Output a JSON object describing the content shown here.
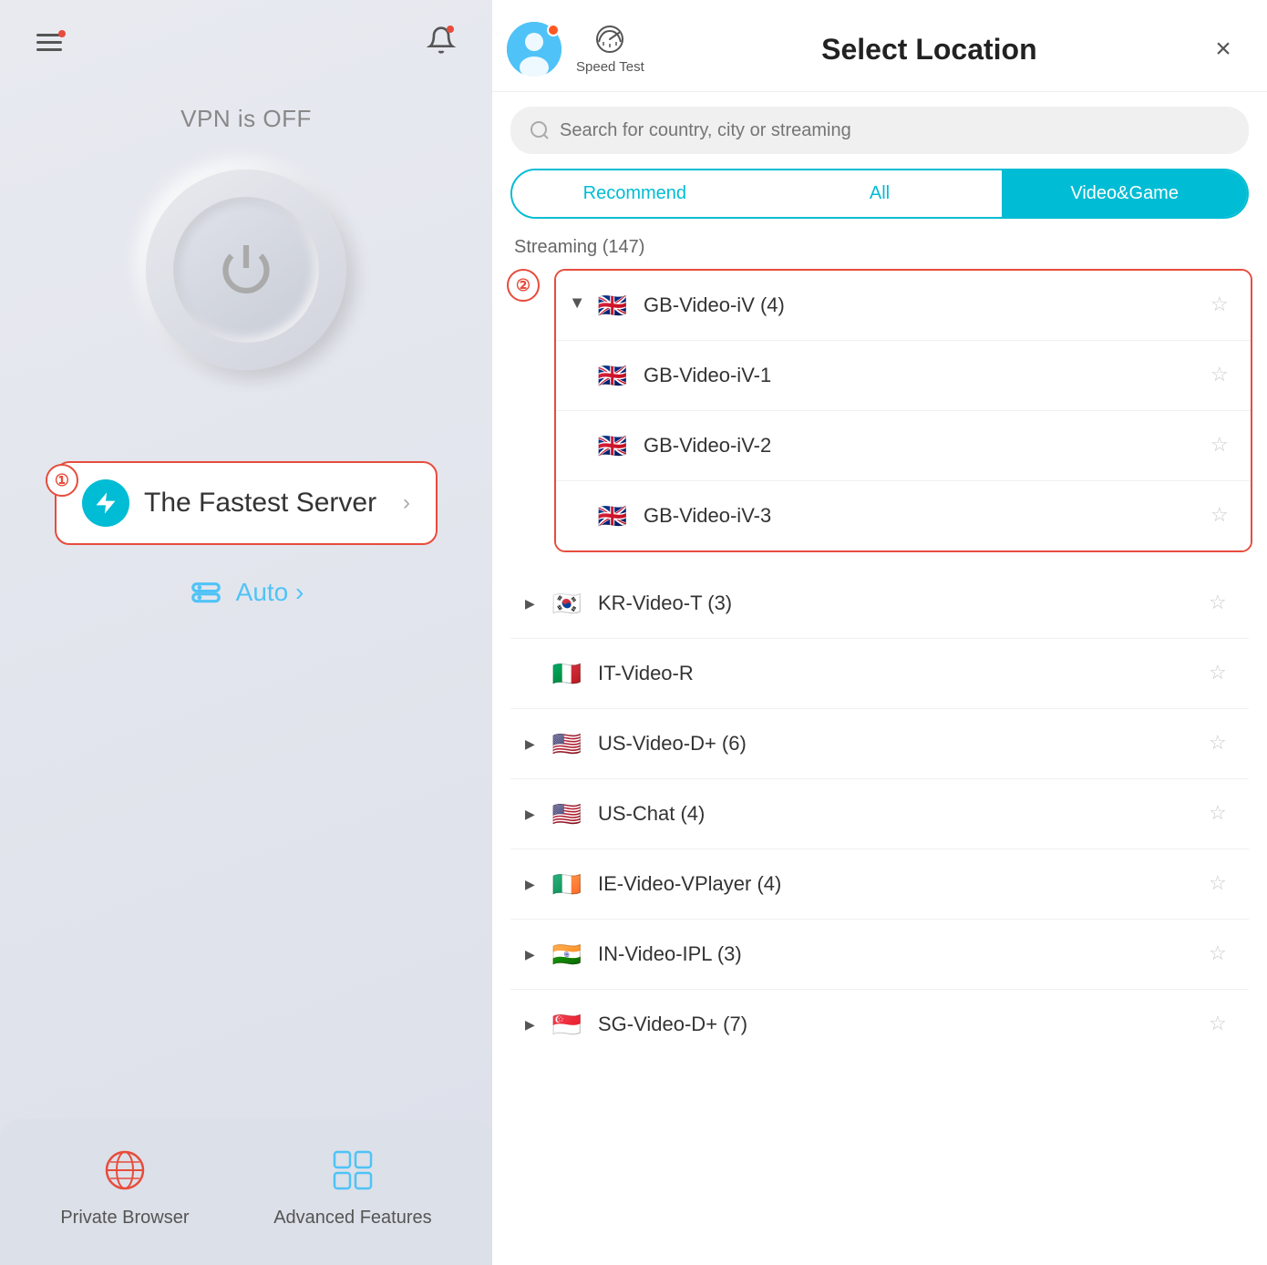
{
  "left": {
    "vpn_status": "VPN is OFF",
    "fastest_server_label": "The Fastest Server",
    "fastest_server_chevron": "›",
    "auto_label": "Auto ›",
    "bottom_items": [
      {
        "id": "private-browser",
        "label": "Private Browser"
      },
      {
        "id": "advanced-features",
        "label": "Advanced Features"
      }
    ],
    "annotation1": "①"
  },
  "right": {
    "header": {
      "speed_test_label": "Speed Test",
      "title": "Select Location",
      "close_label": "×"
    },
    "search": {
      "placeholder": "Search for country, city or streaming"
    },
    "tabs": [
      {
        "id": "recommend",
        "label": "Recommend",
        "active": false
      },
      {
        "id": "all",
        "label": "All",
        "active": false
      },
      {
        "id": "videogame",
        "label": "Video&Game",
        "active": true
      }
    ],
    "streaming_header": "Streaming (147)",
    "annotation2": "②",
    "location_groups": [
      {
        "id": "gb-video-iv",
        "parent": "GB-Video-iV (4)",
        "flag": "🇬🇧",
        "expanded": true,
        "highlighted": true,
        "children": [
          {
            "id": "gb-video-iv-1",
            "name": "GB-Video-iV-1",
            "flag": "🇬🇧"
          },
          {
            "id": "gb-video-iv-2",
            "name": "GB-Video-iV-2",
            "flag": "🇬🇧"
          },
          {
            "id": "gb-video-iv-3",
            "name": "GB-Video-iV-3",
            "flag": "🇬🇧"
          }
        ]
      }
    ],
    "plain_locations": [
      {
        "id": "kr-video-t",
        "name": "KR-Video-T (3)",
        "flag": "🇰🇷",
        "expandable": true
      },
      {
        "id": "it-video-r",
        "name": "IT-Video-R",
        "flag": "🇮🇹",
        "expandable": false
      },
      {
        "id": "us-video-dplus",
        "name": "US-Video-D+ (6)",
        "flag": "🇺🇸",
        "expandable": true
      },
      {
        "id": "us-chat",
        "name": "US-Chat (4)",
        "flag": "🇺🇸",
        "expandable": true
      },
      {
        "id": "ie-video-vplayer",
        "name": "IE-Video-VPlayer (4)",
        "flag": "🇮🇪",
        "expandable": true
      },
      {
        "id": "in-video-ipl",
        "name": "IN-Video-IPL (3)",
        "flag": "🇮🇳",
        "expandable": true
      },
      {
        "id": "sg-video-dplus",
        "name": "SG-Video-D+ (7)",
        "flag": "🇸🇬",
        "expandable": true
      }
    ]
  }
}
